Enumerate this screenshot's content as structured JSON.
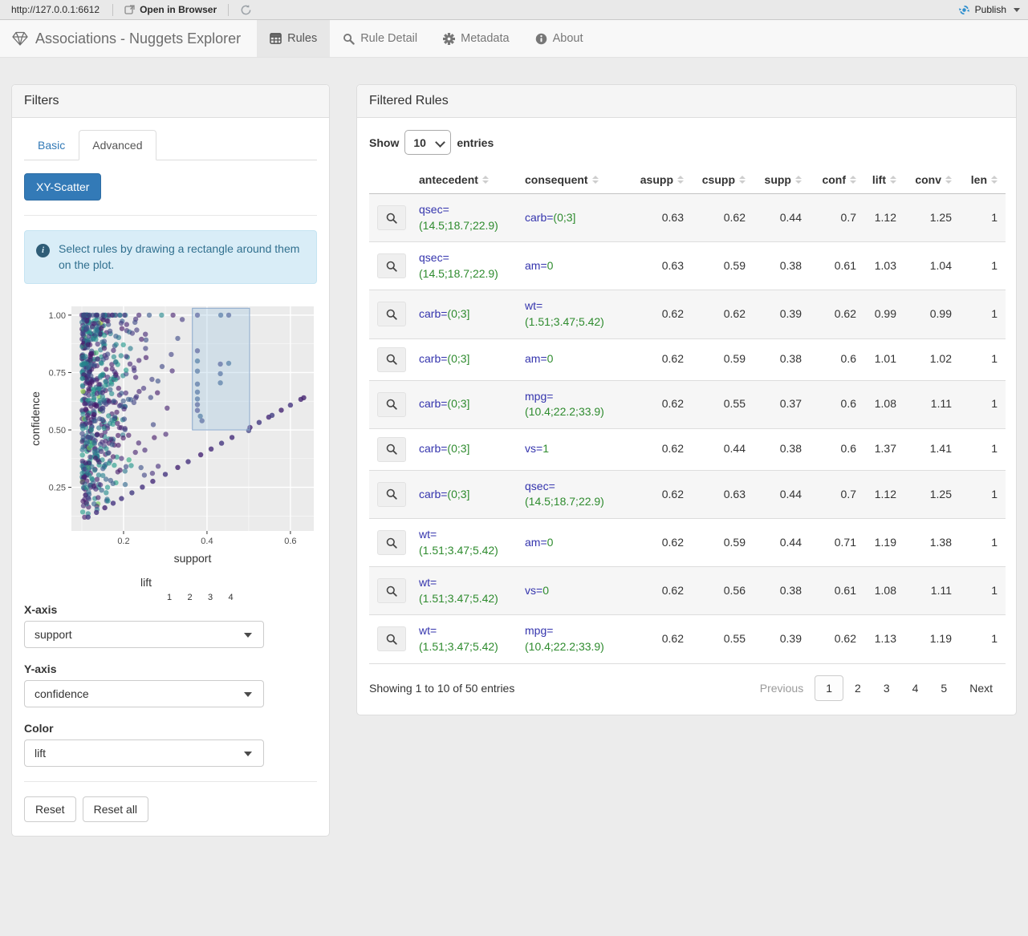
{
  "browser_bar": {
    "url": "http://127.0.0.1:6612",
    "open_in_browser": "Open in Browser",
    "publish_label": "Publish"
  },
  "navbar": {
    "brand": "Associations - Nuggets Explorer",
    "tabs": [
      {
        "label": "Rules",
        "icon": "table-icon",
        "active": true
      },
      {
        "label": "Rule Detail",
        "icon": "search-icon",
        "active": false
      },
      {
        "label": "Metadata",
        "icon": "gear-icon",
        "active": false
      },
      {
        "label": "About",
        "icon": "info-icon",
        "active": false
      }
    ]
  },
  "filters": {
    "title": "Filters",
    "tabs": [
      {
        "label": "Basic",
        "active": false
      },
      {
        "label": "Advanced",
        "active": true
      }
    ],
    "scatter_button": "XY-Scatter",
    "alert_text": "Select rules by drawing a rectangle around them on the plot.",
    "controls": [
      {
        "label": "X-axis",
        "value": "support"
      },
      {
        "label": "Y-axis",
        "value": "confidence"
      },
      {
        "label": "Color",
        "value": "lift"
      }
    ],
    "reset_label": "Reset",
    "reset_all_label": "Reset all"
  },
  "chart_data": {
    "type": "scatter",
    "xlabel": "support",
    "ylabel": "confidence",
    "x_ticks": [
      0.2,
      0.4,
      0.6
    ],
    "y_ticks": [
      0.25,
      0.5,
      0.75,
      1.0
    ],
    "x_minor_ticks": [
      0.1,
      0.3,
      0.5
    ],
    "y_minor_ticks": [
      0.125,
      0.375,
      0.625,
      0.875
    ],
    "x_range": [
      0.075,
      0.656
    ],
    "y_range": [
      0.06,
      1.038
    ],
    "color_legend": {
      "label": "lift",
      "ticks": [
        1,
        2,
        3,
        4
      ],
      "colormap": "viridis",
      "range": [
        0.45,
        5.0
      ]
    },
    "selection_rect": {
      "x": [
        0.365,
        0.502
      ],
      "y": [
        0.5,
        1.03
      ]
    },
    "point_style": {
      "radius": 3.2,
      "opacity": 0.62
    },
    "cloud": {
      "seed": 42,
      "n_dense": 620,
      "n_top_row": 45,
      "x_min": 0.1,
      "x_max": 0.36,
      "x_exp_scale": 0.045
    },
    "diagonal_points_x": [
      0.115,
      0.135,
      0.155,
      0.175,
      0.195,
      0.22,
      0.245,
      0.27,
      0.3,
      0.33,
      0.355,
      0.385,
      0.41,
      0.435,
      0.46,
      0.503,
      0.525,
      0.548,
      0.556,
      0.578,
      0.6,
      0.625,
      0.632
    ],
    "selection_points": [
      [
        0.377,
        1.0
      ],
      [
        0.433,
        1.0
      ],
      [
        0.452,
        1.0
      ],
      [
        0.377,
        0.845
      ],
      [
        0.377,
        0.8
      ],
      [
        0.377,
        0.756
      ],
      [
        0.377,
        0.7
      ],
      [
        0.377,
        0.665
      ],
      [
        0.377,
        0.635
      ],
      [
        0.377,
        0.61
      ],
      [
        0.377,
        0.585
      ],
      [
        0.432,
        0.787
      ],
      [
        0.432,
        0.745
      ],
      [
        0.432,
        0.705
      ],
      [
        0.452,
        0.79
      ],
      [
        0.384,
        0.56
      ],
      [
        0.388,
        0.54
      ],
      [
        0.5,
        0.497
      ]
    ]
  },
  "rules_panel": {
    "title": "Filtered Rules",
    "show_label": "Show",
    "entries_label": "entries",
    "page_length": "10",
    "columns": [
      "antecedent",
      "consequent",
      "asupp",
      "csupp",
      "supp",
      "conf",
      "lift",
      "conv",
      "len"
    ],
    "rows": [
      {
        "antecedent": {
          "name": "qsec=",
          "value": "(14.5;18.7;22.9)"
        },
        "consequent": {
          "name": "carb=",
          "value": "(0;3]"
        },
        "asupp": "0.63",
        "csupp": "0.62",
        "supp": "0.44",
        "conf": "0.7",
        "lift": "1.12",
        "conv": "1.25",
        "len": "1"
      },
      {
        "antecedent": {
          "name": "qsec=",
          "value": "(14.5;18.7;22.9)"
        },
        "consequent": {
          "name": "am=",
          "value": "0"
        },
        "asupp": "0.63",
        "csupp": "0.59",
        "supp": "0.38",
        "conf": "0.61",
        "lift": "1.03",
        "conv": "1.04",
        "len": "1"
      },
      {
        "antecedent": {
          "name": "carb=",
          "value": "(0;3]"
        },
        "consequent": {
          "name": "wt=",
          "value": "(1.51;3.47;5.42)"
        },
        "asupp": "0.62",
        "csupp": "0.62",
        "supp": "0.39",
        "conf": "0.62",
        "lift": "0.99",
        "conv": "0.99",
        "len": "1"
      },
      {
        "antecedent": {
          "name": "carb=",
          "value": "(0;3]"
        },
        "consequent": {
          "name": "am=",
          "value": "0"
        },
        "asupp": "0.62",
        "csupp": "0.59",
        "supp": "0.38",
        "conf": "0.6",
        "lift": "1.01",
        "conv": "1.02",
        "len": "1"
      },
      {
        "antecedent": {
          "name": "carb=",
          "value": "(0;3]"
        },
        "consequent": {
          "name": "mpg=",
          "value": "(10.4;22.2;33.9)"
        },
        "asupp": "0.62",
        "csupp": "0.55",
        "supp": "0.37",
        "conf": "0.6",
        "lift": "1.08",
        "conv": "1.11",
        "len": "1"
      },
      {
        "antecedent": {
          "name": "carb=",
          "value": "(0;3]"
        },
        "consequent": {
          "name": "vs=",
          "value": "1"
        },
        "asupp": "0.62",
        "csupp": "0.44",
        "supp": "0.38",
        "conf": "0.6",
        "lift": "1.37",
        "conv": "1.41",
        "len": "1"
      },
      {
        "antecedent": {
          "name": "carb=",
          "value": "(0;3]"
        },
        "consequent": {
          "name": "qsec=",
          "value": "(14.5;18.7;22.9)"
        },
        "asupp": "0.62",
        "csupp": "0.63",
        "supp": "0.44",
        "conf": "0.7",
        "lift": "1.12",
        "conv": "1.25",
        "len": "1"
      },
      {
        "antecedent": {
          "name": "wt=",
          "value": "(1.51;3.47;5.42)"
        },
        "consequent": {
          "name": "am=",
          "value": "0"
        },
        "asupp": "0.62",
        "csupp": "0.59",
        "supp": "0.44",
        "conf": "0.71",
        "lift": "1.19",
        "conv": "1.38",
        "len": "1"
      },
      {
        "antecedent": {
          "name": "wt=",
          "value": "(1.51;3.47;5.42)"
        },
        "consequent": {
          "name": "vs=",
          "value": "0"
        },
        "asupp": "0.62",
        "csupp": "0.56",
        "supp": "0.38",
        "conf": "0.61",
        "lift": "1.08",
        "conv": "1.11",
        "len": "1"
      },
      {
        "antecedent": {
          "name": "wt=",
          "value": "(1.51;3.47;5.42)"
        },
        "consequent": {
          "name": "mpg=",
          "value": "(10.4;22.2;33.9)"
        },
        "asupp": "0.62",
        "csupp": "0.55",
        "supp": "0.39",
        "conf": "0.62",
        "lift": "1.13",
        "conv": "1.19",
        "len": "1"
      }
    ],
    "info_text": "Showing 1 to 10 of 50 entries",
    "pagination": {
      "previous": "Previous",
      "pages": [
        "1",
        "2",
        "3",
        "4",
        "5"
      ],
      "active_page": "1",
      "next": "Next"
    }
  },
  "colors": {
    "accent_blue": "#337ab7",
    "attr_name_blue": "#3434ad",
    "attr_value_green": "#2e8b2e",
    "alert_bg": "#d9edf7",
    "alert_text": "#31708f",
    "panel_bg": "#ebebeb",
    "publish_blue": "#2f8fce"
  }
}
